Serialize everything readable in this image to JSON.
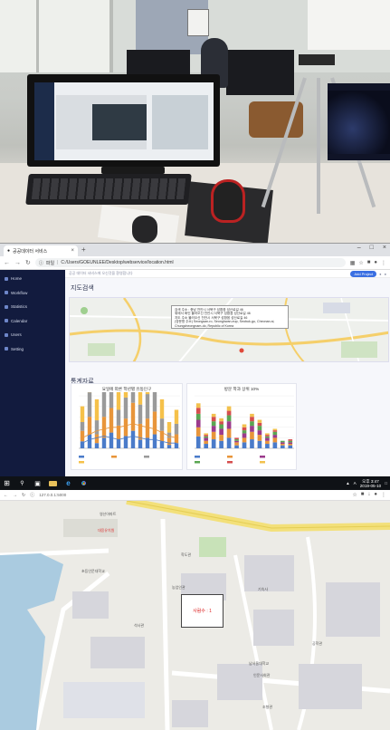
{
  "browser": {
    "tab_title": "공공데이터 서비스",
    "url_prefix": "파일",
    "url": "C:/Users/GOEUNLEE/Desktop/webservice/location.html"
  },
  "sidebar": {
    "items": [
      {
        "label": "Home"
      },
      {
        "label": "Workflow"
      },
      {
        "label": "Statistics"
      },
      {
        "label": "Calendar"
      },
      {
        "label": "Users"
      },
      {
        "label": "Setting"
      }
    ]
  },
  "topline": {
    "left": "공공 데이터 서비스에 오신것을 환영합니다",
    "button": "Add Project"
  },
  "map_section": {
    "title": "지도검색",
    "popup_lines": [
      "검색 주소 : 충남 천안시 서북구 성환읍 성산로길 46",
      "위에서 확인 불러오신 천안시 서북구 성환읍 성산로길 46",
      "지도 주소 불러오신 천안시 서북구 성환읍 성산로길 46",
      "(영문명 주소) Seongsan-ro, Seonghwan-eup, Seobuk-gu, Cheonan-si, Chungcheongnam-do, Republic of Korea"
    ]
  },
  "stats_section": {
    "title": "통계자료"
  },
  "chart_data": [
    {
      "type": "bar",
      "title": "요일에 따른 학년별 유동인구",
      "categories": [
        "",
        "",
        "",
        "",
        "",
        "",
        "",
        "",
        "",
        "",
        "",
        "",
        "",
        ""
      ],
      "series": [
        {
          "values": [
            4,
            8,
            3,
            6,
            9,
            5,
            7,
            10,
            5,
            6,
            8,
            4,
            2,
            3
          ]
        },
        {
          "values": [
            6,
            10,
            5,
            12,
            14,
            8,
            10,
            16,
            9,
            11,
            13,
            6,
            4,
            5
          ]
        },
        {
          "values": [
            5,
            14,
            8,
            16,
            20,
            9,
            12,
            22,
            11,
            14,
            18,
            7,
            3,
            6
          ]
        },
        {
          "values": [
            9,
            18,
            12,
            20,
            24,
            14,
            16,
            26,
            15,
            18,
            20,
            11,
            6,
            8
          ]
        }
      ],
      "lines": [
        [
          6,
          8,
          10,
          11,
          12,
          12,
          13,
          14,
          13,
          12,
          11,
          9,
          7,
          6
        ],
        [
          3,
          5,
          6,
          7,
          6,
          5,
          6,
          7,
          6,
          5,
          5,
          4,
          3,
          3
        ]
      ],
      "colors": [
        "#4a7bc9",
        "#e8953a",
        "#9a9a9a",
        "#f5c14a"
      ],
      "ylim": [
        0,
        30
      ]
    },
    {
      "type": "bar",
      "title": "방문 학과 상위 10%",
      "categories": [
        "",
        "",
        "",
        "",
        "",
        "",
        "",
        "",
        "",
        "",
        "",
        "",
        ""
      ],
      "series": [
        {
          "values": [
            8,
            3,
            6,
            5,
            7,
            2,
            4,
            6,
            5,
            3,
            4,
            2,
            2
          ]
        },
        {
          "values": [
            6,
            2,
            5,
            4,
            6,
            2,
            3,
            5,
            4,
            2,
            3,
            1,
            1
          ]
        },
        {
          "values": [
            5,
            2,
            4,
            4,
            5,
            1,
            3,
            4,
            3,
            2,
            2,
            1,
            1
          ]
        },
        {
          "values": [
            4,
            1,
            3,
            3,
            4,
            1,
            2,
            3,
            3,
            1,
            2,
            1,
            1
          ]
        },
        {
          "values": [
            4,
            1,
            3,
            2,
            3,
            1,
            2,
            3,
            2,
            1,
            1,
            0,
            1
          ]
        },
        {
          "values": [
            3,
            1,
            2,
            2,
            3,
            0,
            2,
            2,
            2,
            1,
            1,
            0,
            0
          ]
        }
      ],
      "colors": [
        "#4a7bc9",
        "#e8953a",
        "#9b3a8c",
        "#5aa652",
        "#d64e4e",
        "#f2c14e"
      ],
      "ylim": [
        0,
        35
      ]
    }
  ],
  "taskbar": {
    "lang": "A",
    "time": "오후 3:47",
    "date": "2019-05-10"
  },
  "browser2": {
    "url": "127.0.0.1:5000"
  },
  "bigmap": {
    "marker": "사람수 : 1",
    "labels": [
      {
        "text": "영산아파트"
      },
      {
        "text": "대웅유치원"
      },
      {
        "text": "학도관"
      },
      {
        "text": "농업인관"
      },
      {
        "text": "초등인문대학교"
      },
      {
        "text": "석사관"
      },
      {
        "text": "기숙사"
      },
      {
        "text": "남서울대학교"
      },
      {
        "text": "인문사회관"
      },
      {
        "text": "공학관"
      },
      {
        "text": "조형관"
      }
    ]
  }
}
